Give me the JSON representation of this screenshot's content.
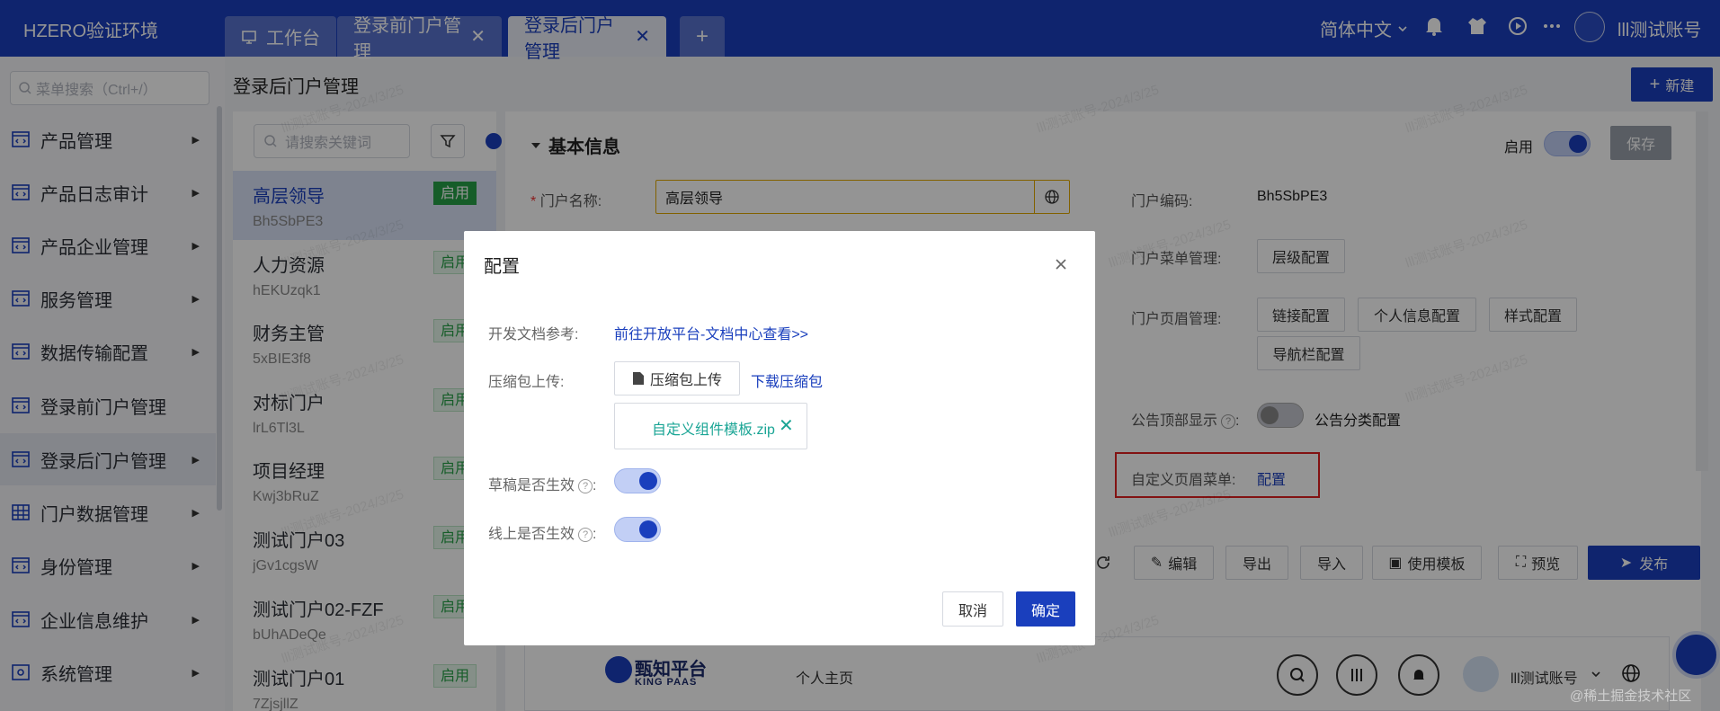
{
  "topbar": {
    "logo": "HZERO验证环境",
    "tabs": [
      {
        "label": "工作台"
      },
      {
        "label": "登录前门户管理",
        "close": "✕"
      },
      {
        "label": "登录后门户管理",
        "close": "✕"
      }
    ],
    "add_tab": "+",
    "language": "简体中文",
    "user": "lll测试账号",
    "colors": {
      "bar": "#1a3fbd",
      "active_tab": "#e8ecf7"
    }
  },
  "sidebar": {
    "search_placeholder": "菜单搜索（Ctrl+/）",
    "items": [
      {
        "label": "产品管理",
        "arrow": "▶",
        "icon": "code-window-icon"
      },
      {
        "label": "产品日志审计",
        "arrow": "▶",
        "icon": "code-window-icon"
      },
      {
        "label": "产品企业管理",
        "arrow": "▶",
        "icon": "code-window-icon"
      },
      {
        "label": "服务管理",
        "arrow": "▶",
        "icon": "code-window-icon"
      },
      {
        "label": "数据传输配置",
        "arrow": "▶",
        "icon": "code-window-icon"
      },
      {
        "label": "登录前门户管理",
        "arrow": "",
        "icon": "code-window-icon"
      },
      {
        "label": "登录后门户管理",
        "arrow": "▶",
        "icon": "code-window-icon"
      },
      {
        "label": "门户数据管理",
        "arrow": "▶",
        "icon": "table-icon"
      },
      {
        "label": "身份管理",
        "arrow": "▶",
        "icon": "code-window-icon"
      },
      {
        "label": "企业信息维护",
        "arrow": "▶",
        "icon": "code-window-icon"
      },
      {
        "label": "系统管理",
        "arrow": "▶",
        "icon": "gear-icon"
      }
    ]
  },
  "page": {
    "title": "登录后门户管理",
    "new_button": "新建",
    "list_search_placeholder": "请搜索关键词",
    "portals": [
      {
        "name": "高层领导",
        "code": "Bh5SbPE3",
        "status": "启用"
      },
      {
        "name": "人力资源",
        "code": "hEKUzqk1",
        "status": "启用"
      },
      {
        "name": "财务主管",
        "code": "5xBIE3f8",
        "status": "启用"
      },
      {
        "name": "对标门户",
        "code": "lrL6Tl3L",
        "status": "启用"
      },
      {
        "name": "项目经理",
        "code": "Kwj3bRuZ",
        "status": "启用"
      },
      {
        "name": "测试门户03",
        "code": "jGv1cgsW",
        "status": "启用"
      },
      {
        "name": "测试门户02-FZF",
        "code": "bUhADeQe",
        "status": "启用"
      },
      {
        "name": "测试门户01",
        "code": "7ZjsjllZ",
        "status": "启用"
      }
    ],
    "section_title": "基本信息",
    "enable_label": "启用",
    "save_button": "保存",
    "fields": {
      "required_mark": "*",
      "name_label": "门户名称:",
      "name_value": "高层领导",
      "code_label": "门户编码:",
      "code_value": "Bh5SbPE3",
      "menu_label": "门户菜单管理:",
      "menu_btn": "层级配置",
      "header_label": "门户页眉管理:",
      "header_btns": [
        "链接配置",
        "个人信息配置",
        "样式配置",
        "导航栏配置"
      ],
      "notice_label": "公告顶部显示",
      "notice_cat": "公告分类配置",
      "custom_header_label": "自定义页眉菜单:",
      "custom_header_link": "配置"
    },
    "toolbar": [
      "编辑",
      "导出",
      "导入",
      "使用模板",
      "预览"
    ],
    "publish": "发布",
    "preview": {
      "brand_cn": "甄知平台",
      "brand_en": "KING PAAS",
      "nav": "个人主页",
      "user": "lll测试账号"
    },
    "watermark": "lll测试账号-2024/3/25"
  },
  "modal": {
    "title": "配置",
    "doc_label": "开发文档参考:",
    "doc_link": "前往开放平台-文档中心查看>>",
    "upload_label": "压缩包上传:",
    "upload_button": "压缩包上传",
    "download_link": "下载压缩包",
    "file_name": "自定义组件模板.zip",
    "draft_label": "草稿是否生效",
    "online_label": "线上是否生效",
    "qmark": "?",
    "colon": ":",
    "cancel": "取消",
    "ok": "确定"
  },
  "footer_watermark": "@稀土掘金技术社区"
}
